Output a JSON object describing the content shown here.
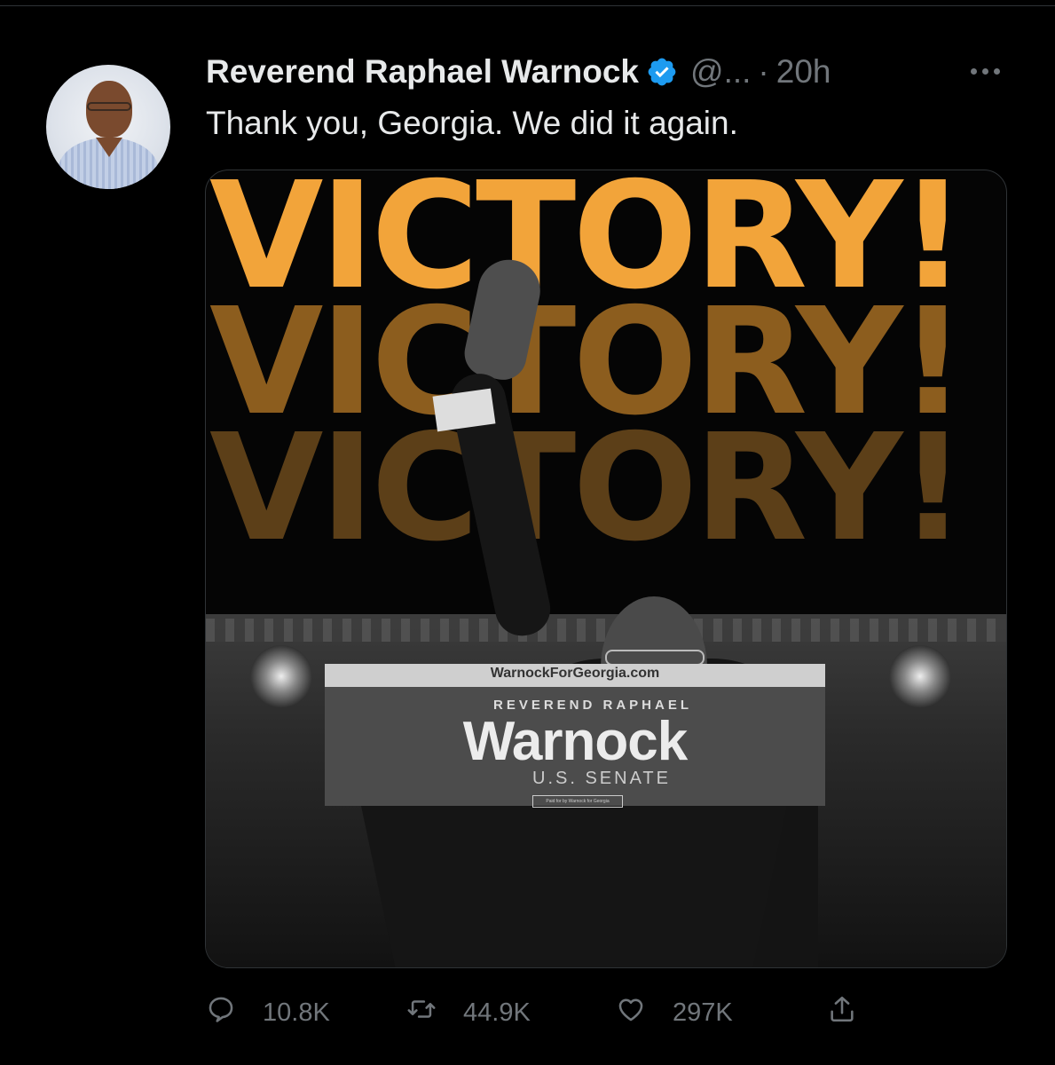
{
  "tweet": {
    "author_name": "Reverend Raphael Warnock",
    "handle": "@...",
    "separator": "·",
    "time": "20h",
    "text": "Thank you, Georgia. We did it again.",
    "more_label": "···"
  },
  "media": {
    "headline_lines": [
      "VICTORY!",
      "VICTORY!",
      "VICTORY!"
    ],
    "podium_site": "WarnockForGeorgia.com",
    "podium_title": "REVEREND RAPHAEL",
    "podium_name": "Warnock",
    "podium_office": "U.S. SENATE",
    "podium_disclaimer": "Paid for by Warnock for Georgia"
  },
  "actions": {
    "replies": "10.8K",
    "retweets": "44.9K",
    "likes": "297K"
  },
  "icons": {
    "verified": "verified-badge-icon",
    "more": "more-icon",
    "reply": "reply-icon",
    "retweet": "retweet-icon",
    "like": "heart-icon",
    "share": "share-icon"
  },
  "colors": {
    "background": "#000000",
    "text_primary": "#e7e9ea",
    "text_secondary": "#71767b",
    "verified_blue": "#1d9bf0",
    "victory_orange": "#f2a43a"
  }
}
